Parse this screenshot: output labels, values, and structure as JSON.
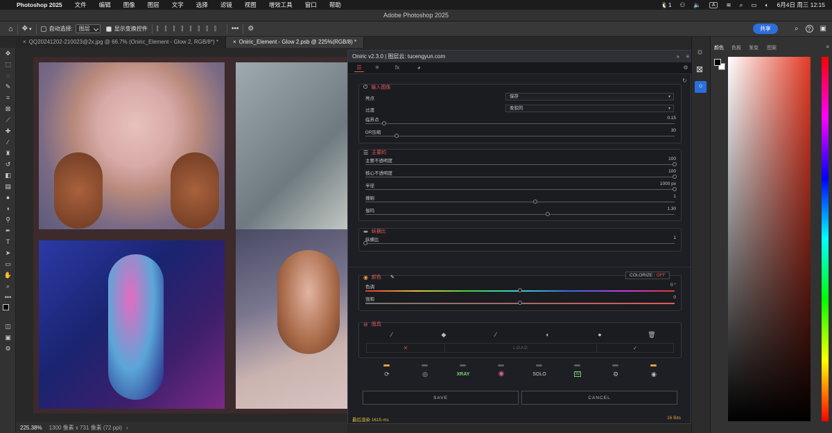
{
  "menubar": {
    "apple_icon": "apple-icon",
    "app_name": "Photoshop 2025",
    "items": [
      "文件",
      "编辑",
      "图像",
      "图层",
      "文字",
      "选择",
      "滤镜",
      "视图",
      "增效工具",
      "窗口",
      "帮助"
    ],
    "right": {
      "qq_badge": "1",
      "input_method": "A",
      "datetime": "6月4日 周三  12:15"
    }
  },
  "window": {
    "title": "Adobe Photoshop 2025"
  },
  "options_bar": {
    "auto_select_label": "自动选择:",
    "auto_select_value": "图层",
    "show_transform_label": "显示变换控件",
    "share_label": "共享"
  },
  "doc_tabs": [
    {
      "label": "QQ20241202-210023@2x.jpg @ 66.7% (Oniric_Element - Glow 2, RGB/8*) *",
      "active": false
    },
    {
      "label": "Oniric_Element - Glow 2.psb @ 225%(RGB/8) *",
      "active": true
    }
  ],
  "status_bar": {
    "zoom": "225.38%",
    "doc_info": "1300 像素 x 731 像素 (72 ppi)"
  },
  "plugin": {
    "header": "Oniric v2.3.0 | 图层云: tucengyun.com",
    "input_section": {
      "title": "输入图像",
      "rows": [
        {
          "label": "亮点",
          "value": "保存"
        },
        {
          "label": "过渡",
          "value": "柔软的"
        }
      ],
      "sliders": [
        {
          "label": "临界点",
          "value": "0.15",
          "pos": 0.06
        },
        {
          "label": "DR压缩",
          "value": "30",
          "pos": 0.1
        }
      ]
    },
    "glow_section": {
      "title": "主要的",
      "sliders": [
        {
          "label": "主要不透明度",
          "value": "100",
          "pos": 1.0
        },
        {
          "label": "核心不透明度",
          "value": "100",
          "pos": 1.0
        },
        {
          "label": "半径",
          "value": "1000 px",
          "pos": 1.0
        },
        {
          "label": "撞剔",
          "value": "1",
          "pos": 0.55
        },
        {
          "label": "伽玛",
          "value": "1.30",
          "pos": 0.59
        }
      ]
    },
    "ratio_section": {
      "title": "纵横比",
      "sliders": [
        {
          "label": "纵横比",
          "value": "1",
          "pos": 0.0
        }
      ]
    },
    "color_section": {
      "title": "颜色",
      "colorize_label": "COLORIZE : ",
      "colorize_state": "OFF",
      "sliders": [
        {
          "label": "色调",
          "value": "0 °",
          "pos": 0.5
        },
        {
          "label": "饱和",
          "value": "0",
          "pos": 0.5
        }
      ]
    },
    "mask_section": {
      "title": "面具",
      "load_label": "LOAD",
      "cancel_mark": "✕",
      "ok_mark": "✓"
    },
    "dock": {
      "xray_label": "XRAY",
      "solo_label": "SOLO",
      "bits_icon": "32",
      "indicators": [
        true,
        false,
        false,
        false,
        false,
        false,
        false,
        true
      ]
    },
    "save_label": "SAVE",
    "cancel_label": "CANCEL",
    "footer_left": "最后渲染 1615 ms",
    "footer_right": "16 Bits"
  },
  "color_panel": {
    "tabs": [
      "颜色",
      "色板",
      "渐变",
      "图案"
    ]
  }
}
